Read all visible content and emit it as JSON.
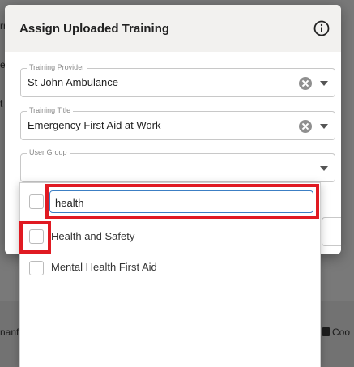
{
  "background": {
    "left_fragments": [
      "rr",
      "e",
      "t"
    ],
    "bottom_left": "nanfo",
    "bottom_right": "Coo"
  },
  "modal": {
    "title": "Assign Uploaded Training",
    "fields": {
      "training_provider": {
        "label": "Training Provider",
        "value": "St John Ambulance"
      },
      "training_title": {
        "label": "Training Title",
        "value": "Emergency First Aid at Work"
      },
      "user_group": {
        "label": "User Group",
        "value": ""
      }
    }
  },
  "dropdown": {
    "search_value": "health",
    "options": [
      {
        "label": "Health and Safety",
        "checked": false
      },
      {
        "label": "Mental Health First Aid",
        "checked": false
      }
    ]
  },
  "colors": {
    "highlight": "#e01a22",
    "focus": "#3c7fc4"
  }
}
